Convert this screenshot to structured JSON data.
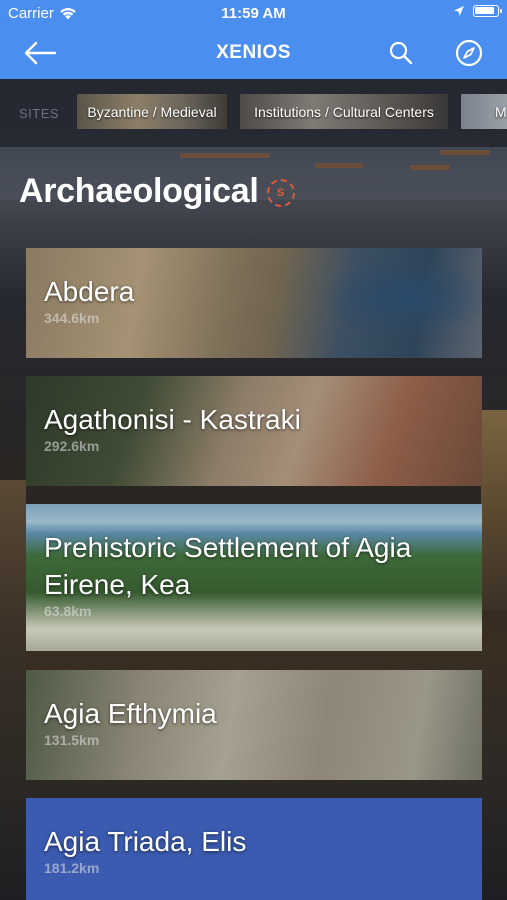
{
  "status_bar": {
    "carrier": "Carrier",
    "time": "11:59 AM"
  },
  "nav": {
    "title": "XENIOS",
    "back_icon": "arrow-left-icon",
    "search_icon": "search-icon",
    "compass_icon": "compass-icon"
  },
  "categories": {
    "sites_label": "SITES",
    "chips": [
      {
        "label": "Byzantine / Medieval"
      },
      {
        "label": "Institutions / Cultural Centers"
      },
      {
        "label": "M"
      }
    ]
  },
  "section": {
    "title": "Archaeological",
    "badge": "S"
  },
  "sites": [
    {
      "name": "Abdera",
      "distance": "344.6km"
    },
    {
      "name": "Agathonisi - Kastraki",
      "distance": "292.6km"
    },
    {
      "name_line1": "Prehistoric Settlement of Agia",
      "name_line2": "Eirene, Kea",
      "distance": "63.8km"
    },
    {
      "name": "Agia Efthymia",
      "distance": "131.5km"
    },
    {
      "name": "Agia Triada, Elis",
      "distance": "181.2km"
    }
  ],
  "colors": {
    "nav_blue": "#4a8ff0",
    "badge_accent": "#e05a3a",
    "selected_card": "#3b5bb0"
  }
}
